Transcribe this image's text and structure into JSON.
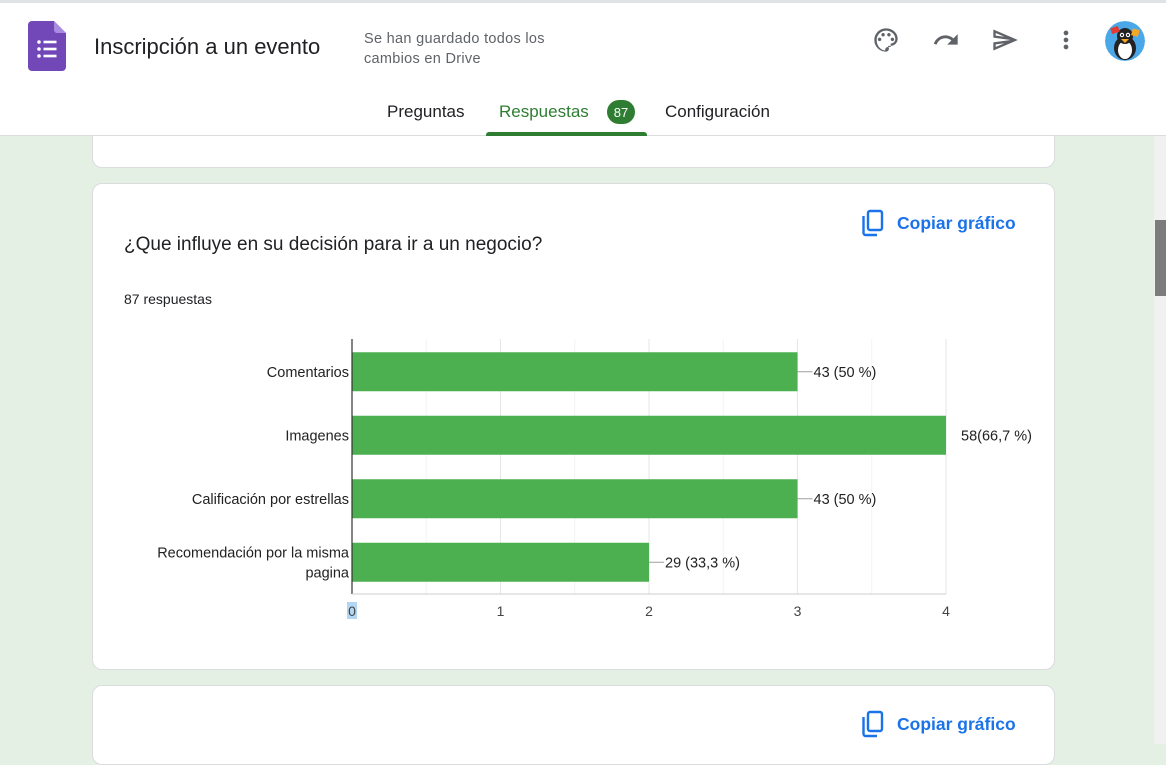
{
  "header": {
    "title": "Inscripción a un evento",
    "save_status": "Se han guardado todos los cambios en Drive",
    "icons": [
      "palette-icon",
      "undo-icon",
      "send-icon",
      "more-vert-icon"
    ]
  },
  "tabs": [
    {
      "label": "Preguntas",
      "active": false
    },
    {
      "label": "Respuestas",
      "active": true,
      "badge": "87"
    },
    {
      "label": "Configuración",
      "active": false
    }
  ],
  "colors": {
    "accent": "#2e7d32",
    "bar": "#4caf50",
    "link": "#1a73e8",
    "background": "#e3f0e3"
  },
  "card": {
    "copy_label": "Copiar gráfico",
    "question": "¿Que influye en su decisión para ir a un negocio?",
    "responses": "87 respuestas"
  },
  "next_card": {
    "copy_label": "Copiar gráfico"
  },
  "chart_data": {
    "type": "bar",
    "orientation": "horizontal",
    "categories": [
      "Comentarios",
      "Imagenes",
      "Calificación por estrellas",
      "Recomendación por la misma pagina"
    ],
    "category_lines": [
      [
        "Comentarios"
      ],
      [
        "Imagenes"
      ],
      [
        "Calificación por estrellas"
      ],
      [
        "Recomendación por la misma",
        "pagina"
      ]
    ],
    "values": [
      3,
      4,
      3,
      2
    ],
    "data_labels": [
      "43 (50 %)",
      "58(66,7 %)",
      "43 (50 %)",
      "29 (33,3 %)"
    ],
    "xlim": [
      0,
      4
    ],
    "ticks": [
      "0",
      "1",
      "2",
      "3",
      "4"
    ],
    "grid": true
  }
}
